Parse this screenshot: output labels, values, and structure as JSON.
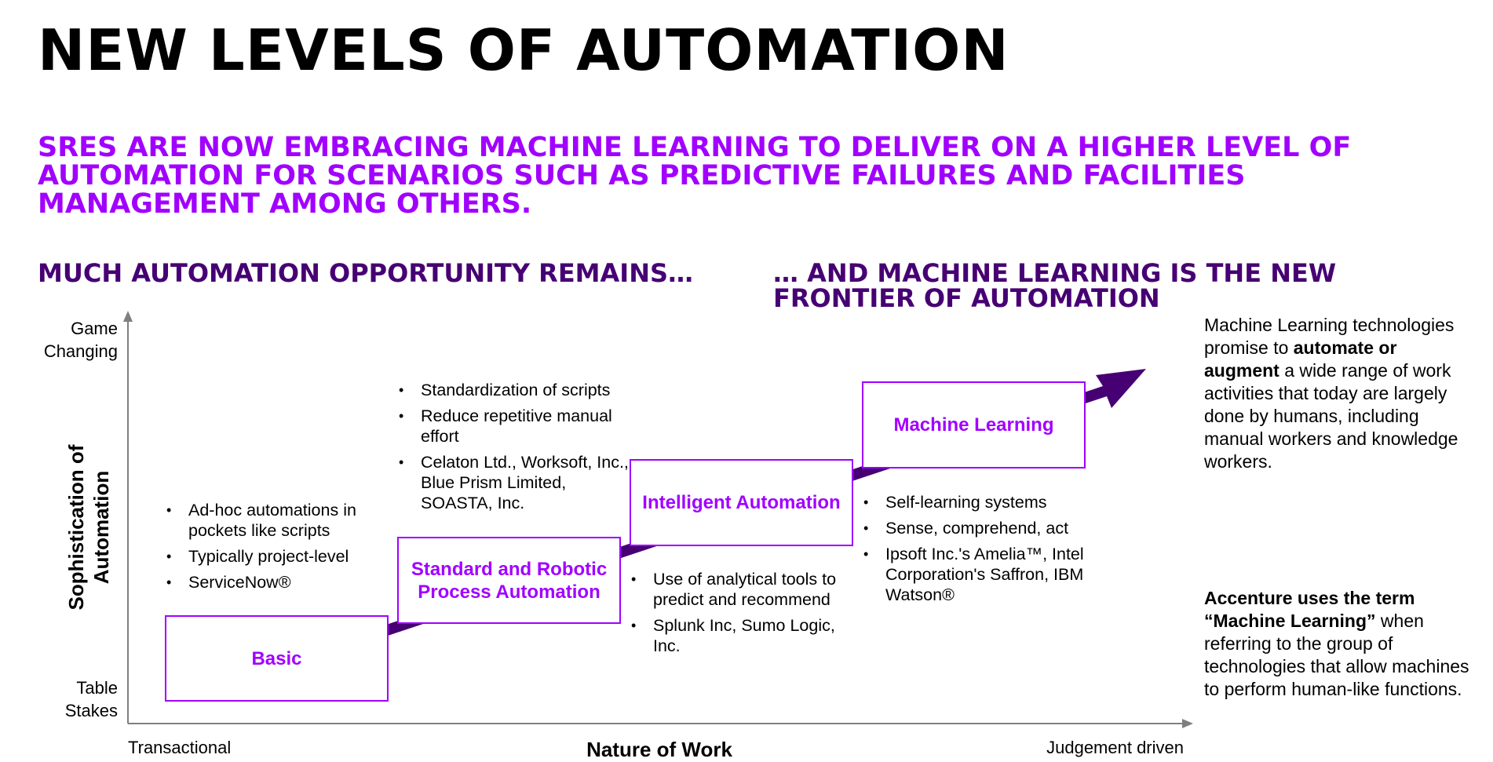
{
  "title": "NEW LEVELS OF AUTOMATION",
  "subtitle": "SRES ARE NOW EMBRACING MACHINE LEARNING TO DELIVER ON A HIGHER LEVEL OF AUTOMATION FOR SCENARIOS SUCH AS PREDICTIVE FAILURES AND FACILITIES MANAGEMENT AMONG OTHERS.",
  "left_heading": "MUCH AUTOMATION OPPORTUNITY REMAINS…",
  "right_heading": "… AND MACHINE LEARNING IS THE NEW FRONTIER OF AUTOMATION",
  "axis": {
    "y_top": "Game Changing",
    "y_bottom": "Table Stakes",
    "y_title": "Sophistication of Automation",
    "x_left": "Transactional",
    "x_title": "Nature of Work",
    "x_right": "Judgement driven"
  },
  "stages": [
    {
      "label": "Basic",
      "bullets": [
        "Ad-hoc automations in pockets like scripts",
        "Typically project-level",
        "ServiceNow®"
      ]
    },
    {
      "label": "Standard and Robotic Process Automation",
      "bullets": [
        "Standardization of scripts",
        "Reduce repetitive manual effort",
        "Celaton Ltd., Worksoft, Inc., Blue Prism Limited, SOASTA, Inc."
      ]
    },
    {
      "label": "Intelligent Automation",
      "bullets": [
        "Use of analytical tools to predict and recommend",
        "Splunk Inc, Sumo Logic, Inc."
      ]
    },
    {
      "label": "Machine Learning",
      "bullets": [
        "Self-learning systems",
        "Sense, comprehend, act",
        "Ipsoft Inc.'s Amelia™, Intel Corporation's Saffron, IBM Watson®"
      ]
    }
  ],
  "side_note_1": {
    "pre": "Machine Learning technologies promise to ",
    "bold": "automate or augment",
    "post": " a wide range of work activities that today are largely done by humans, including manual workers and knowledge workers."
  },
  "side_note_2": {
    "bold": "Accenture uses the term “Machine Learning”",
    "post": " when referring to the group of technologies that allow machines to perform human-like functions."
  },
  "colors": {
    "accent": "#a100ff",
    "dark_purple": "#460073",
    "text": "#000000"
  }
}
